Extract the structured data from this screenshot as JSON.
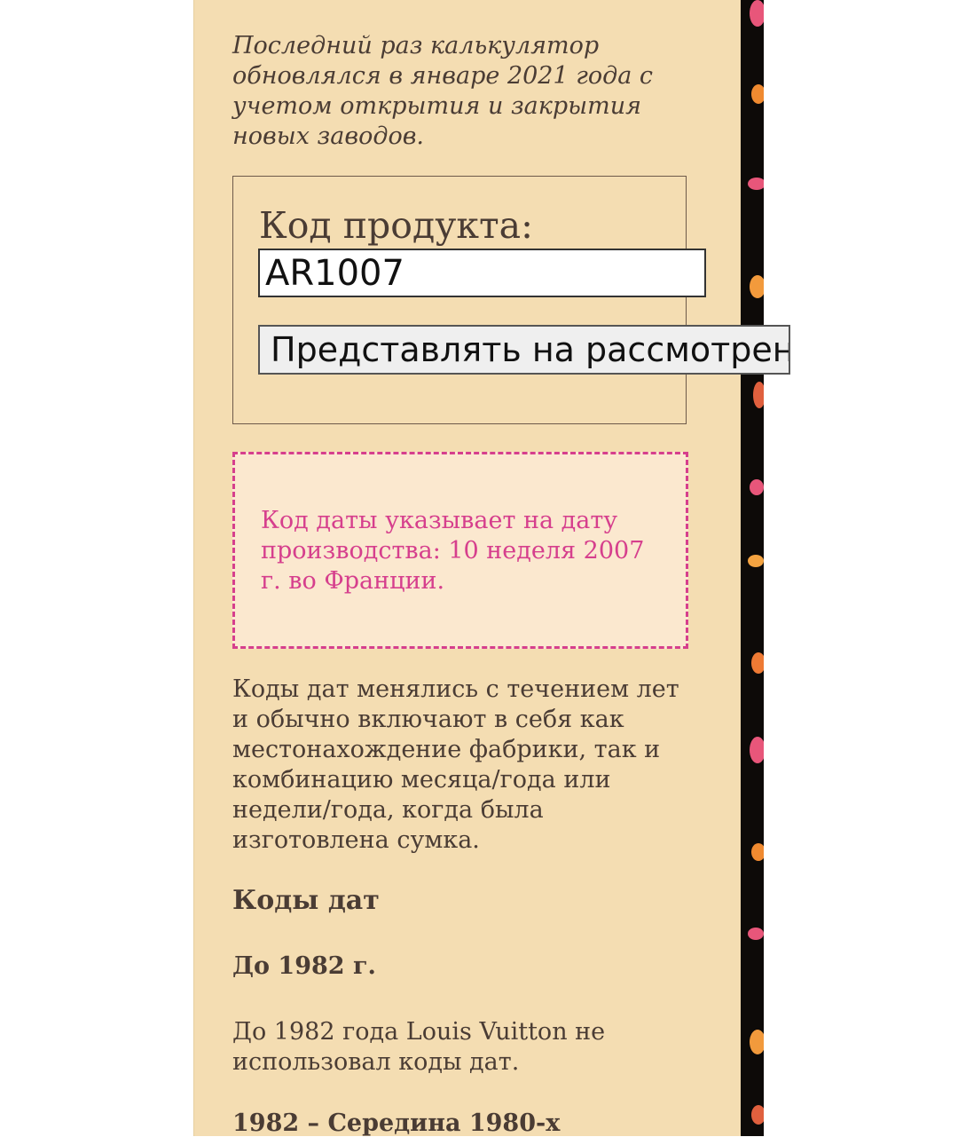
{
  "notice": {
    "lines": [
      "Последний раз калькулятор",
      "обновлялся в январе 2021 года с",
      "учетом открытия и закрытия",
      "новых заводов."
    ]
  },
  "form": {
    "label": "Код продукта:",
    "input_value": "AR1007",
    "submit_label": "Представлять на рассмотрение"
  },
  "result": {
    "lines": [
      "Код даты указывает на дату",
      "производства: 10 неделя 2007",
      "г. во Франции."
    ],
    "color": "#d63f8d"
  },
  "description": {
    "lines": [
      "Коды дат менялись с течением лет",
      "и обычно включают в себя как",
      "местонахождение фабрики, так и",
      "комбинацию месяца/года или",
      "недели/года, когда была",
      "изготовлена сумка."
    ]
  },
  "date_codes": {
    "heading": "Коды дат",
    "pre_1982_heading": "До 1982 г.",
    "pre_1982_lines": [
      "До 1982 года Louis Vuitton не",
      "использовал коды дат."
    ],
    "next_heading": "1982 – Середина 1980-х"
  },
  "colors": {
    "page_background": "#f4ddb2",
    "text": "#4a3c34",
    "accent": "#d63f8d",
    "strip": "#0d0a08"
  }
}
